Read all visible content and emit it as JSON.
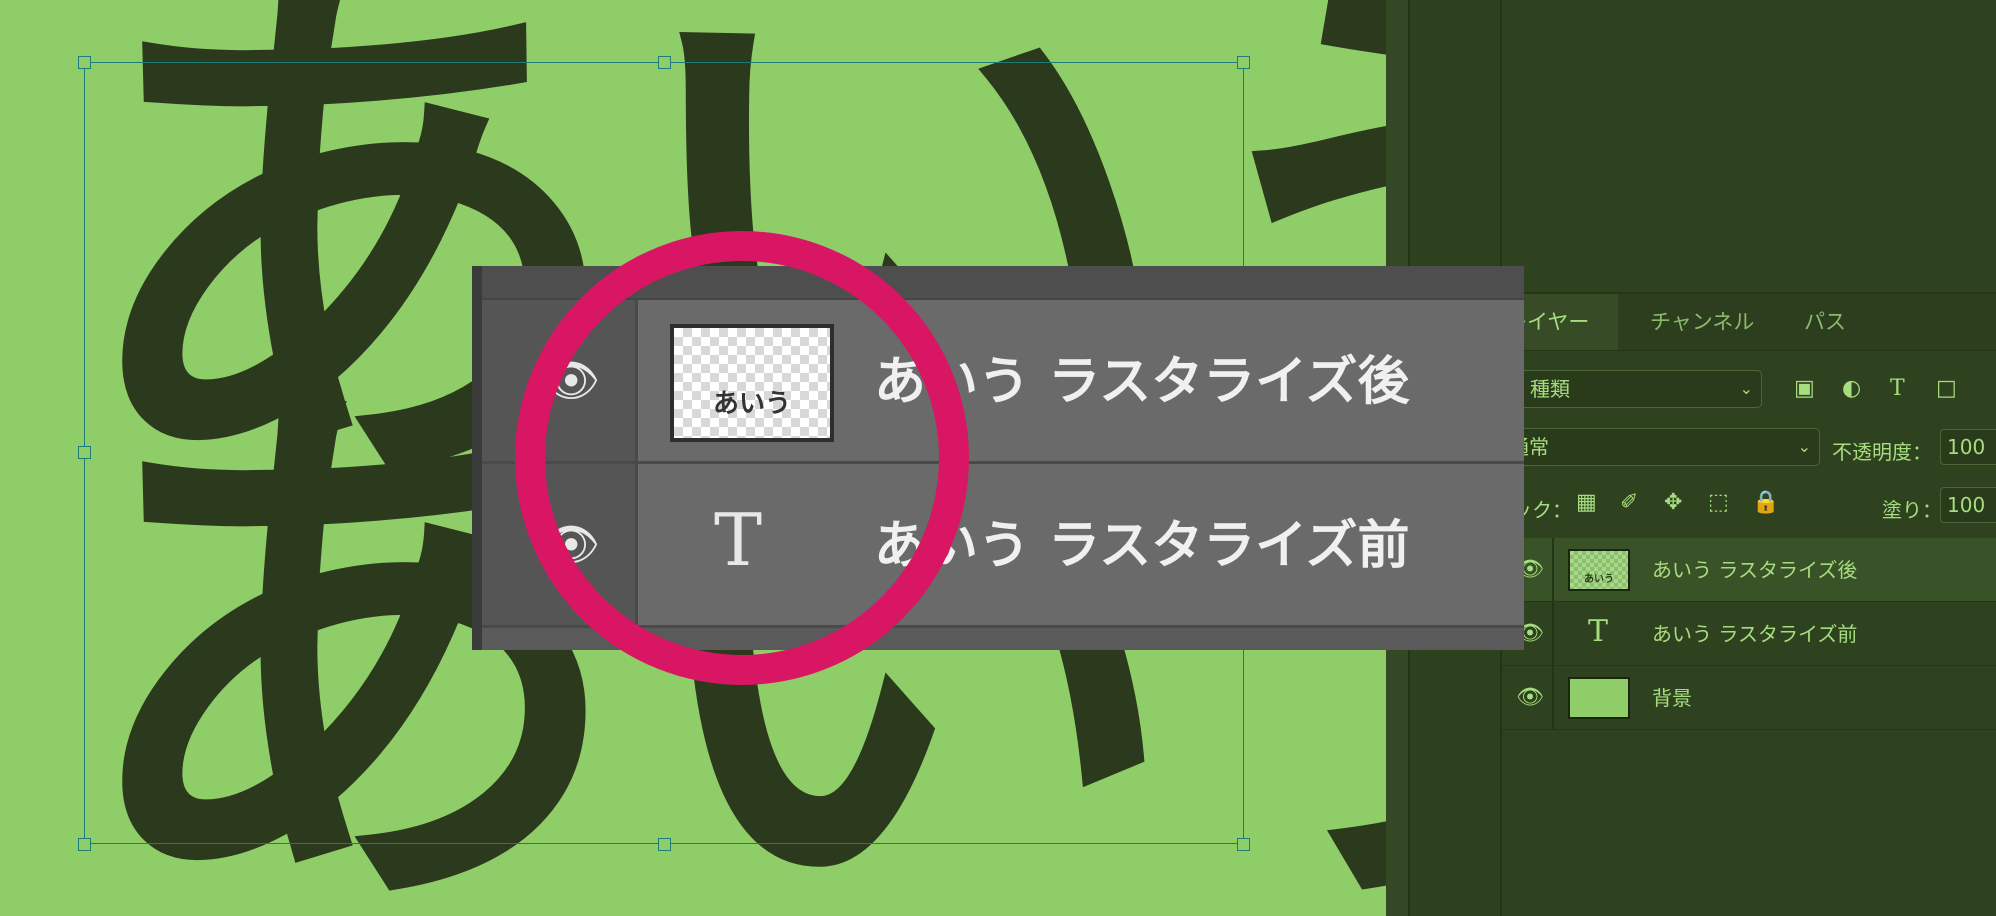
{
  "canvas": {
    "big_text_line1": "あいう",
    "big_text_line2": "あいう"
  },
  "zoom_popup": {
    "layers": [
      {
        "name": "あいう ラスタライズ後",
        "thumb_text": "あいう",
        "kind": "raster"
      },
      {
        "name": "あいう ラスタライズ前",
        "kind": "text",
        "type_icon": "T"
      }
    ]
  },
  "layers_panel": {
    "tabs": [
      "レイヤー",
      "チャンネル",
      "パス"
    ],
    "filter": {
      "icon": "search-icon",
      "value": "種類"
    },
    "filter_icons": [
      "image-icon",
      "adjustment-icon",
      "type-icon",
      "shape-icon"
    ],
    "blend_mode": "通常",
    "opacity_label": "不透明度：",
    "opacity_value": "100",
    "lock_label": "ロック：",
    "fill_label": "塗り：",
    "fill_value": "100",
    "layers": [
      {
        "name": "あいう ラスタライズ後",
        "thumb_text": "あいう",
        "selected": true
      },
      {
        "name": "あいう ラスタライズ前",
        "type_icon": "T",
        "selected": false
      },
      {
        "name": "背景",
        "selected": false
      }
    ]
  },
  "colors": {
    "canvas_bg": "#8fcd69",
    "text_color": "#2b3a1c",
    "highlight_circle": "#d81663",
    "panel_bg": "#2f421f",
    "panel_text": "#a6dd7f"
  }
}
